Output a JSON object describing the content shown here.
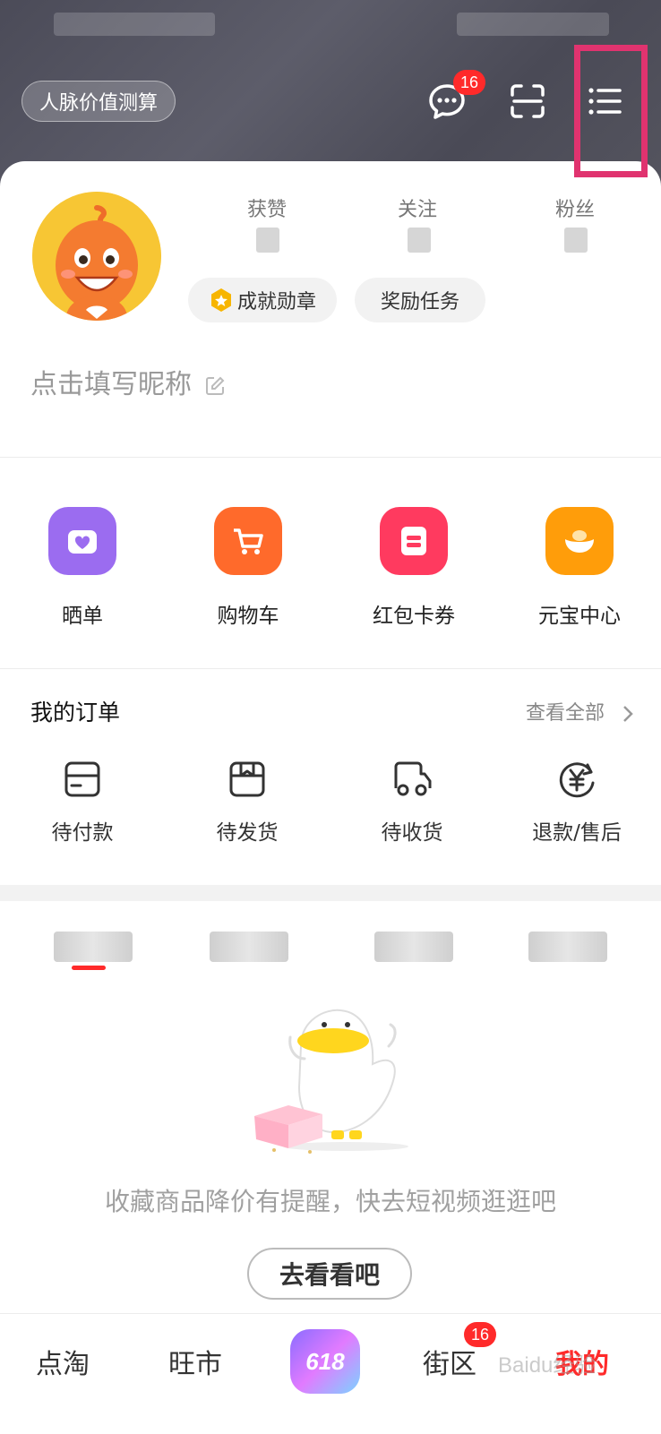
{
  "header": {
    "pill_button": "人脉价值测算",
    "messages_badge": "16"
  },
  "profile": {
    "stats": [
      {
        "label": "获赞"
      },
      {
        "label": "关注"
      },
      {
        "label": "粉丝"
      }
    ],
    "chips": [
      "成就勋章",
      "奖励任务"
    ],
    "nickname_placeholder": "点击填写昵称"
  },
  "quick_actions": [
    {
      "label": "晒单",
      "color": "#9b6cf0"
    },
    {
      "label": "购物车",
      "color": "#ff6a2b"
    },
    {
      "label": "红包卡券",
      "color": "#ff3a5f"
    },
    {
      "label": "元宝中心",
      "color": "#ff9d0a"
    }
  ],
  "orders": {
    "title": "我的订单",
    "see_all": "查看全部",
    "items": [
      "待付款",
      "待发货",
      "待收货",
      "退款/售后"
    ]
  },
  "content": {
    "empty_text": "收藏商品降价有提醒，快去短视频逛逛吧",
    "cta": "去看看吧"
  },
  "bottom_nav": {
    "items": [
      "点淘",
      "旺市",
      "618",
      "街区",
      "我的"
    ],
    "street_badge": "16",
    "active_color": "#ff2a2a"
  },
  "watermark": "Baidu经验"
}
